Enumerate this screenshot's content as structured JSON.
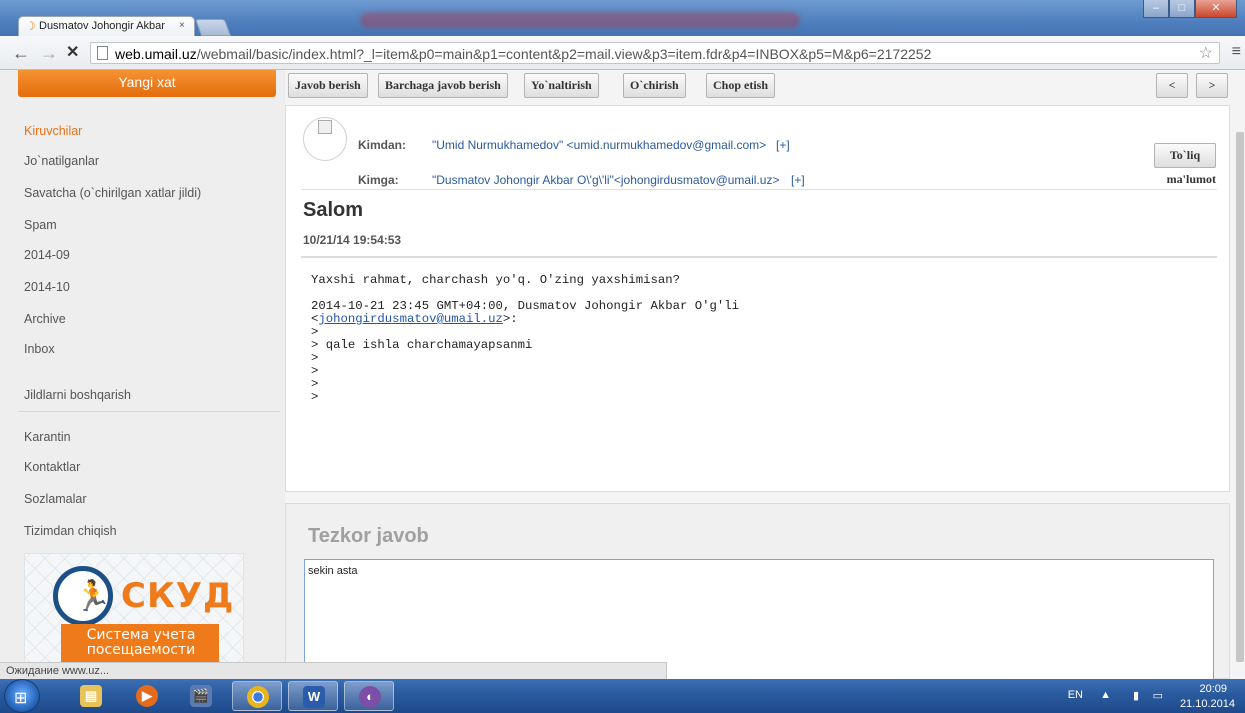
{
  "browser": {
    "tab_title": "Dusmatov Johongir Akbar",
    "tab_close": "×",
    "url_host": "web.umail.uz",
    "url_path": "/webmail/basic/index.html?_l=item&p0=main&p1=content&p2=mail.view&p3=item.fdr&p4=INBOX&p5=M&p6=2172252",
    "back": "←",
    "forward": "→",
    "stop": "✕",
    "star": "☆",
    "menu": "≡",
    "win_min": "–",
    "win_max": "□",
    "win_close": "✕"
  },
  "sidebar": {
    "compose_label": "Yangi xat",
    "folders": [
      "Kiruvchilar",
      "Jo`natilganlar",
      "Savatcha (o`chirilgan xatlar jildi)",
      "Spam",
      "2014-09",
      "2014-10",
      "Archive",
      "Inbox"
    ],
    "manage_folders": "Jildlarni boshqarish",
    "bottom_links": [
      "Karantin",
      "Kontaktlar",
      "Sozlamalar",
      "Tizimdan chiqish"
    ],
    "ad": {
      "brand": "СКУД",
      "text": "Система учета посещаемости"
    }
  },
  "toolbar": {
    "reply": "Javob berish",
    "reply_all": "Barchaga javob berish",
    "forward": "Yo`naltirish",
    "delete": "O`chirish",
    "print": "Chop etish",
    "prev": "<",
    "next": ">"
  },
  "message": {
    "from_label": "Kimdan:",
    "from_value": "\"Umid Nurmukhamedov\" <umid.nurmukhamedov@gmail.com>",
    "to_label": "Kimga:",
    "to_value": "\"Dusmatov Johongir Akbar O\\'g\\'li\"<johongirdusmatov@umail.uz>",
    "plus": "[+]",
    "full_info_1": "To`liq",
    "full_info_2": "ma'lumot",
    "subject": "Salom",
    "date": "10/21/14 19:54:53",
    "body_line1": "Yaxshi rahmat, charchash yo'q. O'zing yaxshimisan?",
    "body_line2": "2014-10-21 23:45 GMT+04:00, Dusmatov Johongir Akbar O'g'li",
    "body_email": "johongirdusmatov@umail.uz",
    "body_quote": ">\n> qale ishla charchamayapsanmi\n>\n>\n>\n>"
  },
  "quick_reply": {
    "title": "Tezkor javob",
    "value": "sekin asta"
  },
  "status_text": "Ожидание www.uz...",
  "taskbar": {
    "lang": "EN",
    "time": "20:09",
    "date": "21.10.2014"
  }
}
